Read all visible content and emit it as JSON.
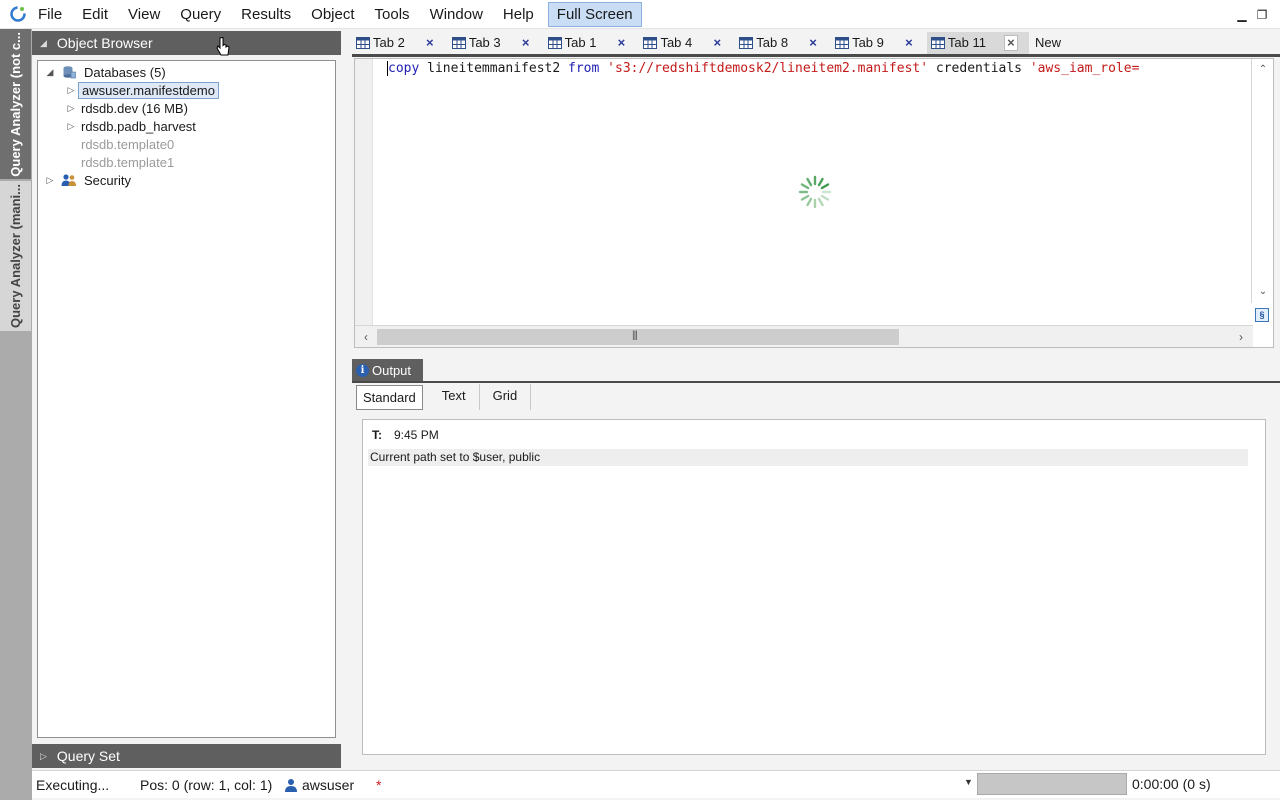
{
  "menubar": {
    "items": [
      "File",
      "Edit",
      "View",
      "Query",
      "Results",
      "Object",
      "Tools",
      "Window",
      "Help"
    ],
    "fullscreen_label": "Full Screen",
    "window_controls": [
      "minimize-icon",
      "restore-icon"
    ]
  },
  "side_tabs": [
    {
      "label": "Query Analyzer (not c...",
      "active": true
    },
    {
      "label": "Query Analyzer (mani...",
      "active": false
    }
  ],
  "object_browser": {
    "title": "Object Browser",
    "tree": [
      {
        "label": "Databases (5)",
        "icon": "database-icon",
        "level": 0,
        "expanded": true
      },
      {
        "label": "awsuser.manifestdemo",
        "level": 1,
        "expander": true,
        "selected": true
      },
      {
        "label": "rdsdb.dev (16 MB)",
        "level": 1,
        "expander": true
      },
      {
        "label": "rdsdb.padb_harvest",
        "level": 1,
        "expander": true
      },
      {
        "label": "rdsdb.template0",
        "level": 1,
        "dim": true
      },
      {
        "label": "rdsdb.template1",
        "level": 1,
        "dim": true
      },
      {
        "label": "Security",
        "icon": "users-icon",
        "level": 0,
        "expanded": false
      }
    ]
  },
  "query_set": {
    "title": "Query Set"
  },
  "tabs": [
    {
      "label": "Tab 2"
    },
    {
      "label": "Tab 3"
    },
    {
      "label": "Tab 1"
    },
    {
      "label": "Tab 4"
    },
    {
      "label": "Tab 8"
    },
    {
      "label": "Tab 9"
    },
    {
      "label": "Tab 11",
      "active": true
    }
  ],
  "new_tab_label": "New",
  "editor": {
    "tokens": [
      {
        "t": "copy",
        "c": "kw"
      },
      {
        "t": " lineitemmanifest2 ",
        "c": "ident"
      },
      {
        "t": "from",
        "c": "kw"
      },
      {
        "t": " ",
        "c": "ident"
      },
      {
        "t": "'s3://redshiftdemosk2/lineitem2.manifest'",
        "c": "str"
      },
      {
        "t": " credentials ",
        "c": "ident"
      },
      {
        "t": "'aws_iam_role=",
        "c": "str"
      }
    ]
  },
  "output": {
    "tab_label": "Output",
    "view_tabs": [
      "Standard",
      "Text",
      "Grid"
    ],
    "active_view": "Standard",
    "time_label": "T:",
    "time_value": "9:45 PM",
    "message": "Current path set to $user, public"
  },
  "status": {
    "state": "Executing...",
    "position": "Pos: 0 (row: 1, col: 1)",
    "user": "awsuser",
    "modified_marker": "*",
    "elapsed": "0:00:00 (0 s)"
  },
  "colors": {
    "panel_header": "#5f5f5f",
    "selection": "#dfe9f6",
    "keyword": "#1f1fb3",
    "string": "#c41a1a",
    "fullscreen_bg": "#c9ddf5"
  }
}
